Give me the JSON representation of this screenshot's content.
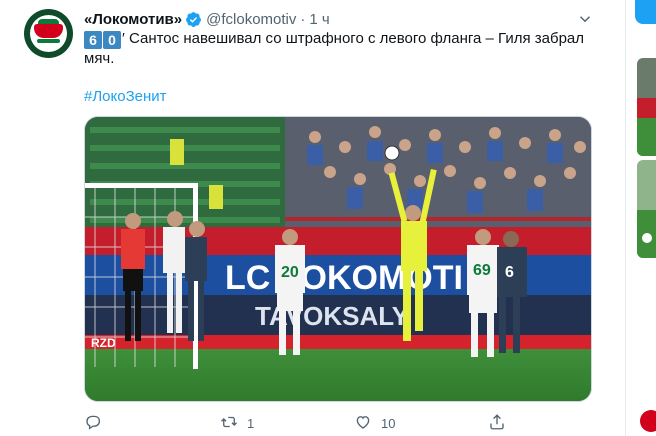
{
  "tweet": {
    "display_name": "«Локомотив»",
    "handle": "@fclokomotiv",
    "separator": "·",
    "time": "1 ч",
    "minute_digit_1": "6",
    "minute_digit_2": "0",
    "text_after": "′ Сантос навешивал со штрафного с левого фланга – Гиля забрал мяч.",
    "hashtag": "#ЛокоЗенит",
    "actions": {
      "reply_count": "",
      "retweet_count": "1",
      "like_count": "10"
    }
  },
  "photo": {
    "ad_boards": [
      "LC LOKOMOTI",
      "TAVOKSALY",
      "RZD"
    ],
    "players": [
      {
        "number": "20",
        "team": "lokomotiv"
      },
      {
        "number": "69",
        "team": "lokomotiv"
      },
      {
        "number": "6",
        "team": "zenit"
      }
    ]
  },
  "icons": {
    "verified": "verified-badge-icon",
    "caret": "chevron-down-icon",
    "reply": "reply-icon",
    "retweet": "retweet-icon",
    "like": "heart-icon",
    "share": "share-icon"
  },
  "colors": {
    "link": "#1da1f2",
    "muted": "#536471",
    "keycap": "#3b88c3",
    "lokomotiv_red": "#d2001a",
    "lokomotiv_green": "#0c7a3a"
  }
}
